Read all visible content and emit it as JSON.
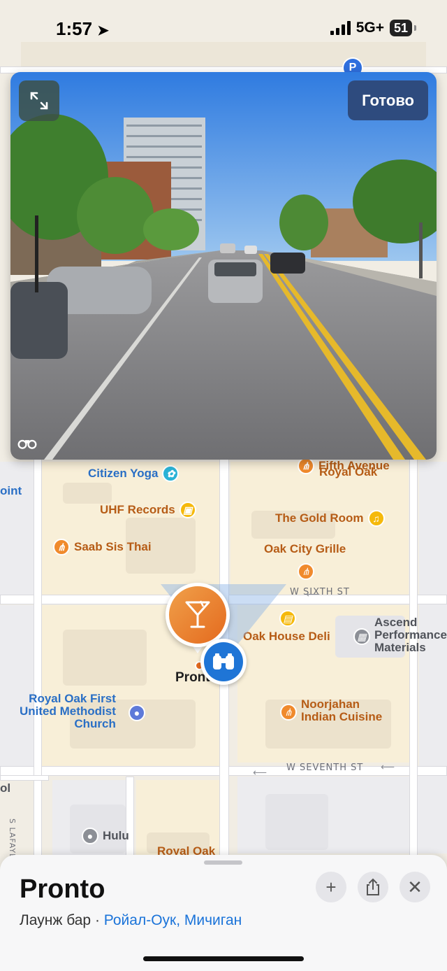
{
  "status_bar": {
    "time": "1:57",
    "network": "5G+",
    "battery": "51"
  },
  "look_around": {
    "done_label": "Готово",
    "expand_icon": "expand-arrows-icon",
    "binoculars_icon": "binoculars-icon"
  },
  "map": {
    "streets": {
      "w_sixth": "W SIXTH ST",
      "w_seventh": "W SEVENTH ST",
      "s_lafayette": "S LAFAYETTE"
    },
    "pois": {
      "citizen_yoga": "Citizen Yoga",
      "fifth_avenue": "Fifth Avenue",
      "royal_oak_1": "Royal Oak",
      "uhf_records": "UHF Records",
      "gold_room": "The Gold Room",
      "saab_sis": "Saab Sis Thai",
      "oak_city": "Oak City Grille",
      "oak_house": "Oak House Deli",
      "ascend_1": "Ascend",
      "ascend_2": "Performance",
      "ascend_3": "Materials",
      "pronto": "Pronto",
      "church_1": "Royal Oak First",
      "church_2": "United Methodist",
      "church_3": "Church",
      "noorjahan_1": "Noorjahan",
      "noorjahan_2": "Indian Cuisine",
      "hulu": "Hulu",
      "royal_oak_bottom": "Royal Oak",
      "point_fragment": "oint",
      "edge_fragment": "ol"
    }
  },
  "place": {
    "name": "Pronto",
    "category": "Лаунж бар · ",
    "location": "Ройал-Оук, Мичиган"
  },
  "colors": {
    "food_accent": "#f08a2c",
    "link_blue": "#1a73d9",
    "done_button": "#2e4b7e",
    "binoculars_marker": "#1f75d6"
  }
}
